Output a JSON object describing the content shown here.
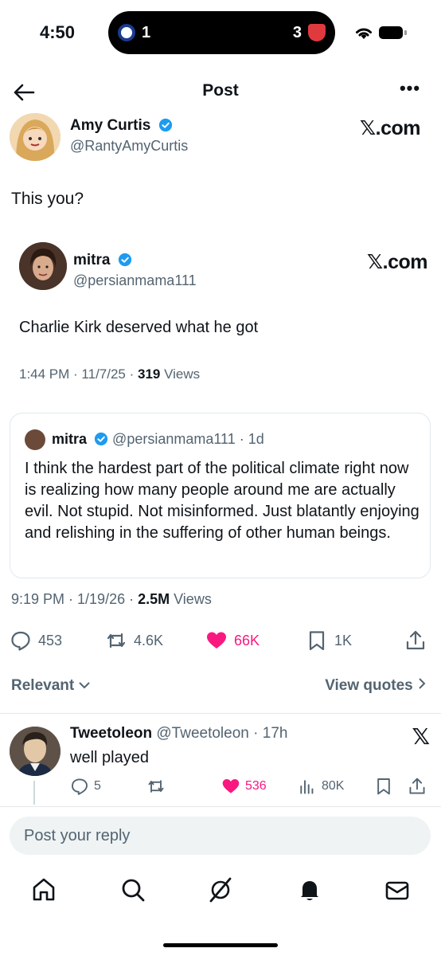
{
  "status_bar": {
    "time": "4:50",
    "live_score": {
      "home_score": "1",
      "away_score": "3"
    }
  },
  "nav": {
    "title": "Post"
  },
  "main_post": {
    "author_name": "Amy Curtis",
    "author_handle": "@RantyAmyCurtis",
    "brand": "𝕏.com",
    "text": "This you?"
  },
  "screenshot_post": {
    "author_name": "mitra",
    "author_handle": "@persianmama111",
    "brand": "𝕏.com",
    "text": "Charlie Kirk deserved what he got",
    "time": "1:44 PM · 11/7/25 · ",
    "views_count": "319",
    "views_label": " Views"
  },
  "quoted_post": {
    "author_name": "mitra",
    "author_handle": "@persianmama111",
    "age": "· 1d",
    "text": "I think the hardest part of the political climate right now is realizing how many people around me are actually evil. Not stupid. Not misinformed. Just blatantly enjoying and relishing in the suffering of other human beings."
  },
  "post_meta": {
    "time": "9:19 PM · 1/19/26 · ",
    "views_count": "2.5M",
    "views_label": " Views"
  },
  "actions": {
    "replies": "453",
    "reposts": "4.6K",
    "likes": "66K",
    "bookmarks": "1K"
  },
  "sort": {
    "relevant_label": "Relevant",
    "view_quotes_label": "View quotes"
  },
  "reply": {
    "author_name": "Tweetoleon",
    "author_handle": "@Tweetoleon",
    "age": "· 17h",
    "text": "well played",
    "replies": "5",
    "likes": "536",
    "views": "80K"
  },
  "composer": {
    "placeholder": "Post your reply"
  },
  "colors": {
    "like": "#f91880",
    "verified": "#1d9bf0",
    "muted": "#536471"
  }
}
